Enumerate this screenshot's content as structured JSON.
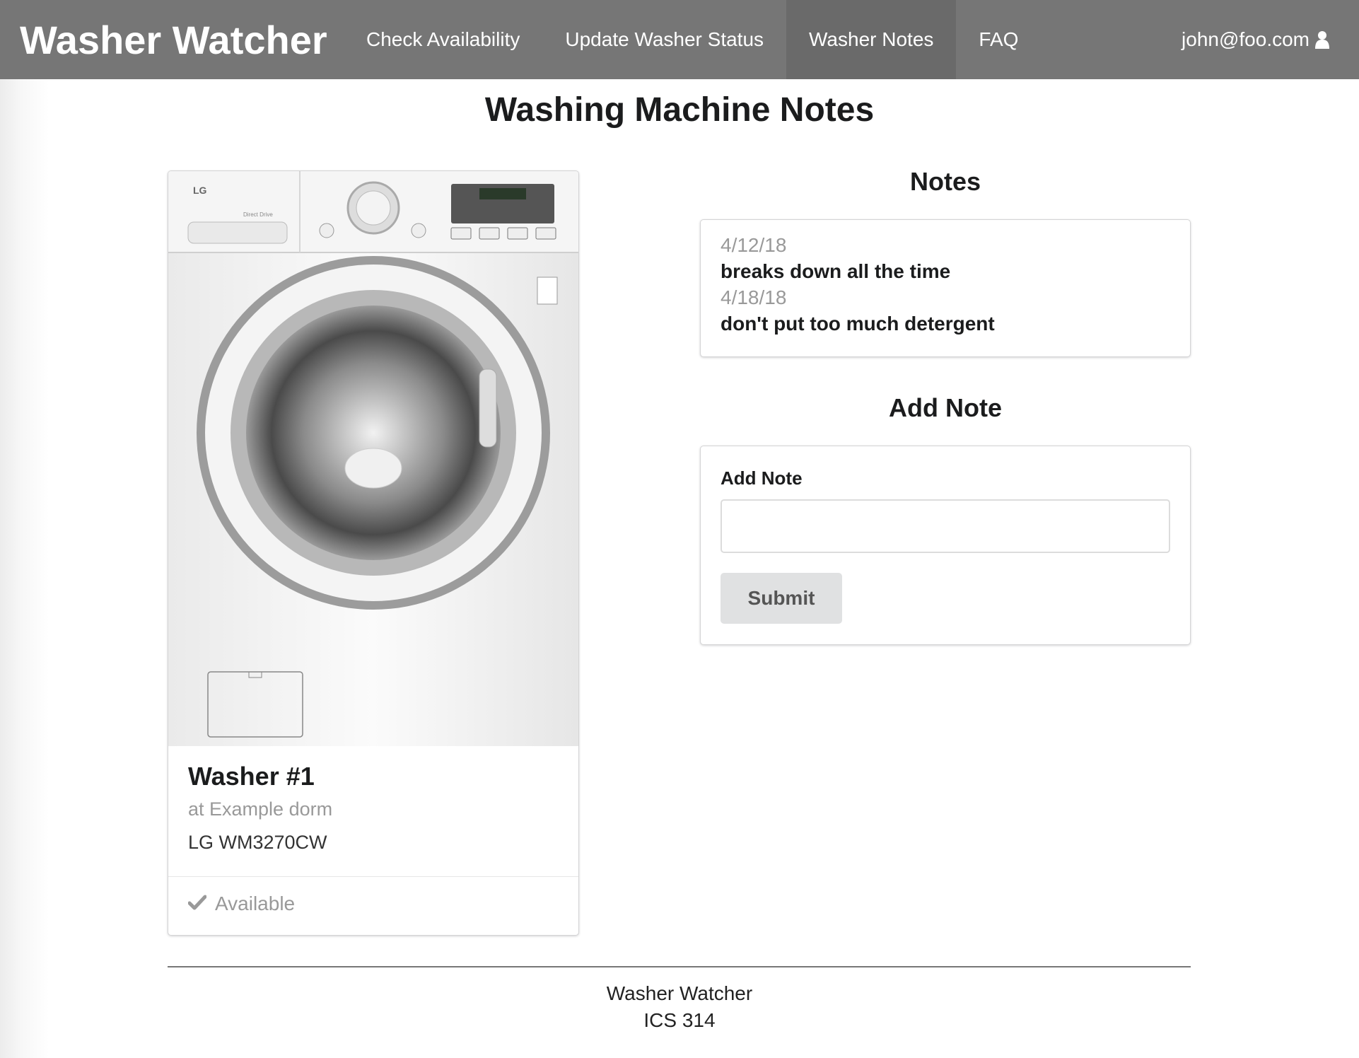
{
  "nav": {
    "brand": "Washer Watcher",
    "items": [
      {
        "label": "Check Availability"
      },
      {
        "label": "Update Washer Status"
      },
      {
        "label": "Washer Notes"
      },
      {
        "label": "FAQ"
      }
    ],
    "user": "john@foo.com",
    "active_item": "Washer Notes"
  },
  "page": {
    "title": "Washing Machine Notes"
  },
  "washer": {
    "name": "Washer #1",
    "location": "at Example dorm",
    "model": "LG WM3270CW",
    "status": "Available",
    "brand_on_image": "LG",
    "panel_label": "Direct Drive"
  },
  "notes_section": {
    "title": "Notes",
    "notes": [
      {
        "date": "4/12/18",
        "text": "breaks down all the time"
      },
      {
        "date": "4/18/18",
        "text": "don't put too much detergent"
      }
    ]
  },
  "add_note": {
    "title": "Add Note",
    "field_label": "Add Note",
    "field_value": "",
    "field_placeholder": "",
    "submit_label": "Submit"
  },
  "footer": {
    "line1": "Washer Watcher",
    "line2": "ICS 314"
  },
  "colors": {
    "navbar": "#767676",
    "navbar_active": "#6a6a6a",
    "button": "#e0e1e2"
  }
}
